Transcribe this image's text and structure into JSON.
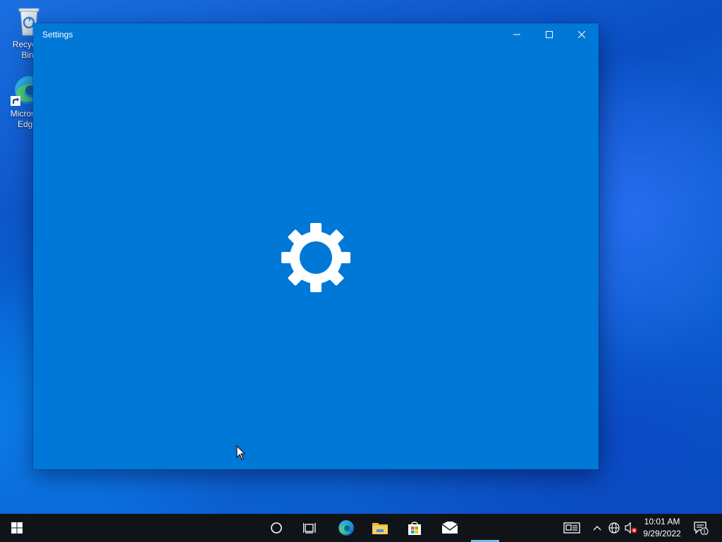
{
  "desktop": {
    "icons": [
      {
        "label": "Recycle\nBin",
        "icon": "recycle-bin-icon"
      },
      {
        "label": "Microsoft\nEdge",
        "icon": "edge-icon"
      }
    ]
  },
  "window": {
    "title": "Settings",
    "accent": "#0078d7",
    "controls": {
      "minimize": "minimize-icon",
      "maximize": "maximize-icon",
      "close": "close-icon"
    },
    "splash_icon": "gear-icon"
  },
  "taskbar": {
    "background": "#101318",
    "start": "windows-logo-icon",
    "items": [
      {
        "name": "search",
        "icon": "cortana-circle-icon"
      },
      {
        "name": "task-view",
        "icon": "task-view-icon"
      },
      {
        "name": "edge",
        "icon": "edge-icon"
      },
      {
        "name": "file-explorer",
        "icon": "folder-icon"
      },
      {
        "name": "store",
        "icon": "store-bag-icon"
      },
      {
        "name": "mail",
        "icon": "mail-icon",
        "active": true
      }
    ],
    "tray": {
      "news_icon": "news-icon",
      "overflow_icon": "chevron-up-icon",
      "network_icon": "globe-network-icon",
      "volume_icon": "volume-muted-icon",
      "time": "10:01 AM",
      "date": "9/29/2022",
      "notifications_icon": "notification-icon",
      "notifications_count": "1"
    }
  }
}
